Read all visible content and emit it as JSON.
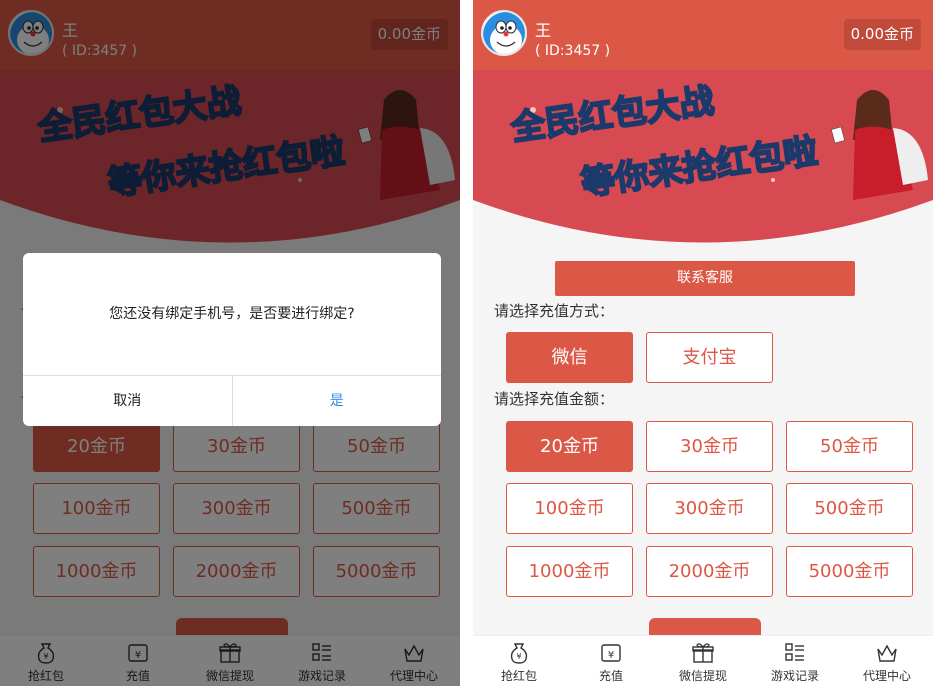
{
  "user": {
    "name": "王",
    "id": "( ID:3457 )",
    "balance": "0.00金币"
  },
  "banner": {
    "line1": "全民红包大战",
    "line2": "等你来抢红包啦"
  },
  "service_button": "联系客服",
  "payment": {
    "label": "请选择充值方式：",
    "options": [
      "微信",
      "支付宝"
    ],
    "selected": "微信"
  },
  "amount": {
    "label": "请选择充值金额：",
    "options": [
      "20金币",
      "30金币",
      "50金币",
      "100金币",
      "300金币",
      "500金币",
      "1000金币",
      "2000金币",
      "5000金币"
    ],
    "selected": "20金币"
  },
  "tabs": [
    {
      "label": "抢红包",
      "icon": "money-bag-icon"
    },
    {
      "label": "充值",
      "icon": "yuan-ticket-icon"
    },
    {
      "label": "微信提现",
      "icon": "gift-icon"
    },
    {
      "label": "游戏记录",
      "icon": "list-icon"
    },
    {
      "label": "代理中心",
      "icon": "crown-icon"
    }
  ],
  "dialog": {
    "message": "您还没有绑定手机号，是否要进行绑定?",
    "cancel": "取消",
    "confirm": "是"
  },
  "colors": {
    "accent": "#dc5846",
    "link": "#3b8be8"
  }
}
